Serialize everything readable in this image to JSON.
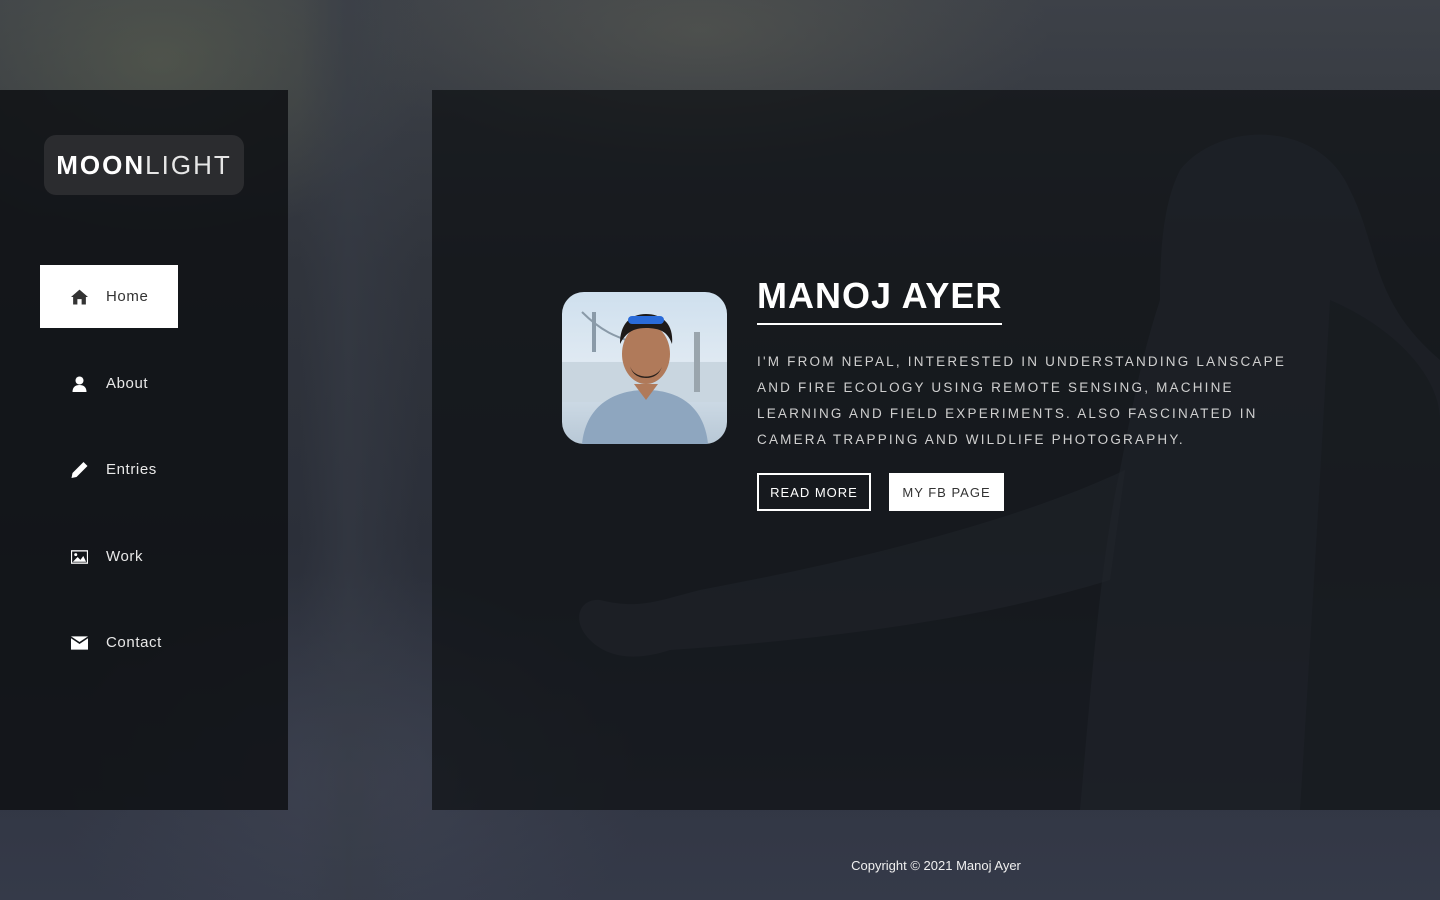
{
  "logo": {
    "bold": "MOON",
    "light": "LIGHT"
  },
  "nav": {
    "items": [
      {
        "label": "Home",
        "icon": "home-icon",
        "active": true
      },
      {
        "label": "About",
        "icon": "user-icon",
        "active": false
      },
      {
        "label": "Entries",
        "icon": "pencil-icon",
        "active": false
      },
      {
        "label": "Work",
        "icon": "image-icon",
        "active": false
      },
      {
        "label": "Contact",
        "icon": "envelope-icon",
        "active": false
      }
    ]
  },
  "profile": {
    "name": "MANOJ AYER",
    "bio": "I'M FROM NEPAL, INTERESTED IN UNDERSTANDING LANSCAPE AND FIRE ECOLOGY USING REMOTE SENSING, MACHINE LEARNING AND FIELD EXPERIMENTS. ALSO FASCINATED IN CAMERA TRAPPING AND WILDLIFE PHOTOGRAPHY.",
    "read_more_label": "READ MORE",
    "fb_label": "MY FB PAGE"
  },
  "footer": {
    "copyright": "Copyright © 2021 Manoj Ayer"
  },
  "colors": {
    "sidebar_bg": "#101216",
    "active_nav_bg": "#ffffff",
    "logo_bg": "#2b2c2f"
  }
}
